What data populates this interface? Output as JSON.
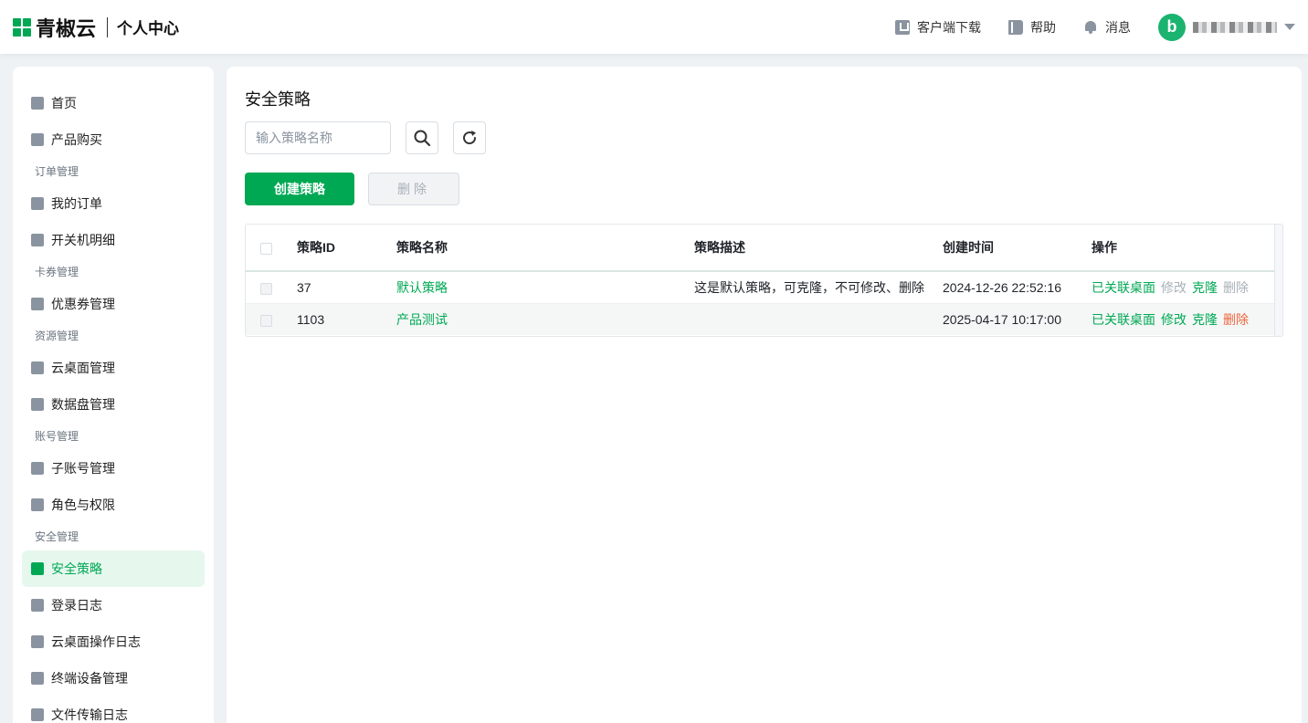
{
  "header": {
    "brand": "青椒云",
    "subtitle": "个人中心",
    "download": "客户端下载",
    "help": "帮助",
    "messages": "消息",
    "avatar_letter": "b",
    "accent": "#01a854"
  },
  "sidebar": {
    "home": "首页",
    "purchase": "产品购买",
    "group_orders": "订单管理",
    "my_orders": "我的订单",
    "power_log": "开关机明细",
    "group_cards": "卡券管理",
    "coupons": "优惠券管理",
    "group_resources": "资源管理",
    "desktops": "云桌面管理",
    "disks": "数据盘管理",
    "group_accounts": "账号管理",
    "subaccounts": "子账号管理",
    "roles": "角色与权限",
    "group_security": "安全管理",
    "policy": "安全策略",
    "login_log": "登录日志",
    "desktop_log": "云桌面操作日志",
    "devices": "终端设备管理",
    "file_log": "文件传输日志"
  },
  "main": {
    "title": "安全策略",
    "search_placeholder": "输入策略名称",
    "create_button": "创建策略",
    "delete_button": "删除",
    "columns": {
      "id": "策略ID",
      "name": "策略名称",
      "desc": "策略描述",
      "time": "创建时间",
      "ops": "操作"
    },
    "rows": [
      {
        "id": "37",
        "name": "默认策略",
        "desc": "这是默认策略，可克隆，不可修改、删除",
        "time": "2024-12-26 22:52:16",
        "op_linked": "已关联桌面",
        "op_edit": "修改",
        "op_clone": "克隆",
        "op_delete": "删除"
      },
      {
        "id": "1103",
        "name": "产品测试",
        "desc": "",
        "time": "2025-04-17 10:17:00",
        "op_linked": "已关联桌面",
        "op_edit": "修改",
        "op_clone": "克隆",
        "op_delete": "删除"
      }
    ]
  }
}
